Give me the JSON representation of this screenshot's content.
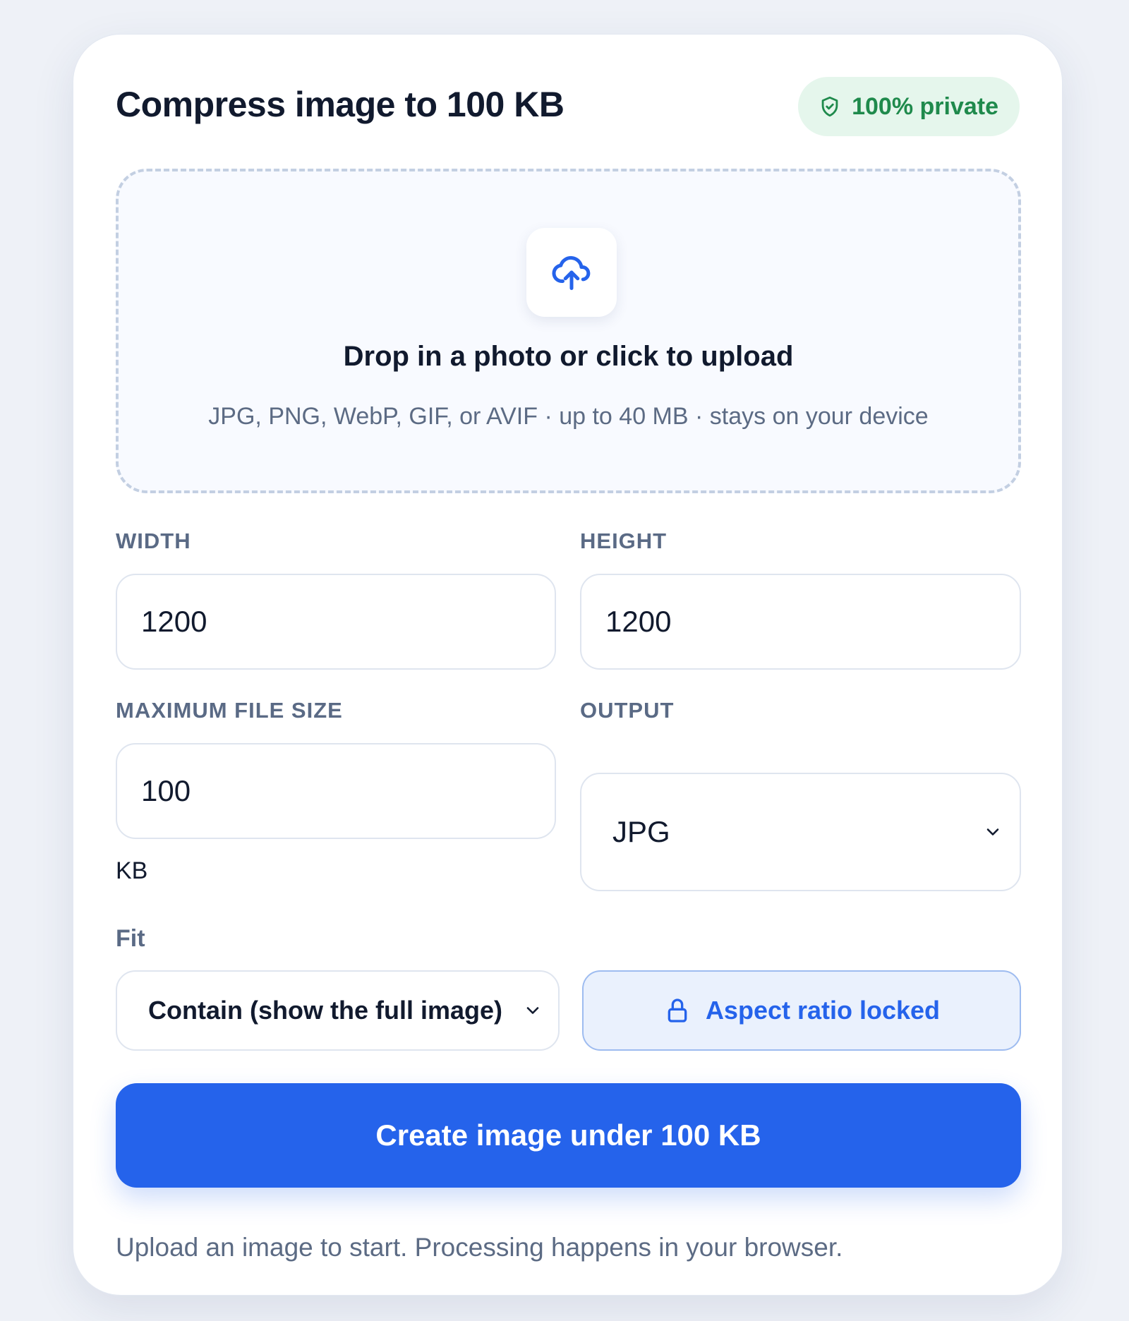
{
  "card": {
    "title": "Compress image to 100 KB",
    "privacy_badge": "100% private"
  },
  "dropzone": {
    "icon": "cloud-upload-icon",
    "title": "Drop in a photo or click to upload",
    "subtitle": "JPG, PNG, WebP, GIF, or AVIF · up to 40 MB · stays on your device"
  },
  "fields": {
    "width": {
      "label": "WIDTH",
      "value": "1200"
    },
    "height": {
      "label": "HEIGHT",
      "value": "1200"
    },
    "max_size": {
      "label": "MAXIMUM FILE SIZE",
      "value": "100",
      "unit": "KB"
    },
    "output": {
      "label": "OUTPUT",
      "value": "JPG"
    },
    "fit": {
      "label": "Fit",
      "value": "Contain (show the full image)"
    }
  },
  "aspect_lock": {
    "label": "Aspect ratio locked",
    "icon": "lock-icon"
  },
  "primary_action": {
    "label": "Create image under 100 KB"
  },
  "status": "Upload an image to start. Processing happens in your browser.",
  "colors": {
    "accent": "#2563eb",
    "privacy_green": "#1f8a4c",
    "privacy_bg": "#e5f6ec",
    "lock_bg": "#eaf1fd"
  }
}
